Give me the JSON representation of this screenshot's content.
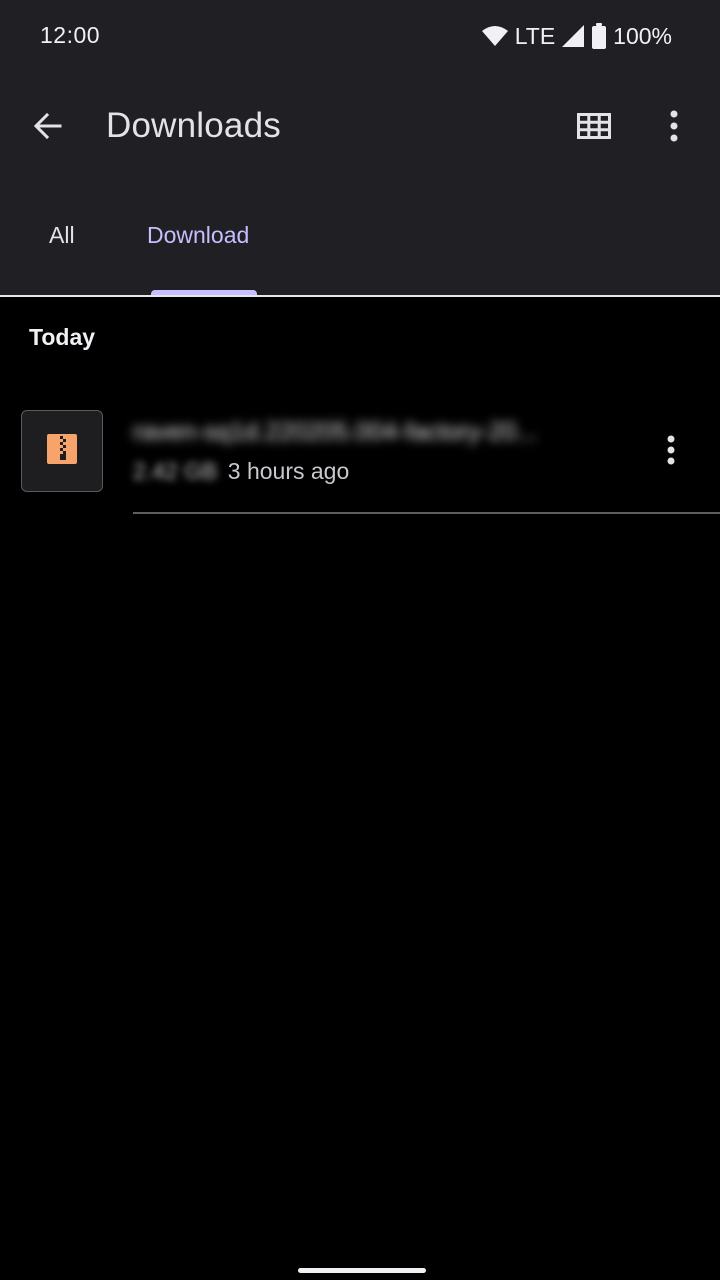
{
  "status_bar": {
    "time": "12:00",
    "network": "LTE",
    "battery": "100%",
    "icons": [
      "wifi-icon",
      "signal-icon",
      "battery-icon"
    ]
  },
  "toolbar": {
    "title": "Downloads",
    "icons": [
      "back-arrow-icon",
      "grid-view-icon",
      "more-vert-icon"
    ]
  },
  "tabs": [
    {
      "label": "All",
      "selected": false
    },
    {
      "label": "Download",
      "selected": true
    }
  ],
  "sections": [
    {
      "header": "Today",
      "files": [
        {
          "name": "raven-sq1d.220205.004-factory-20...",
          "size": "2.42 GB",
          "time": "3 hours ago",
          "icon": "zip-archive-icon"
        }
      ]
    }
  ],
  "colors": {
    "app_bar": "#1f1f24",
    "background": "#000000",
    "accent": "#c6bfff",
    "zip_icon": "#f6a46c"
  }
}
